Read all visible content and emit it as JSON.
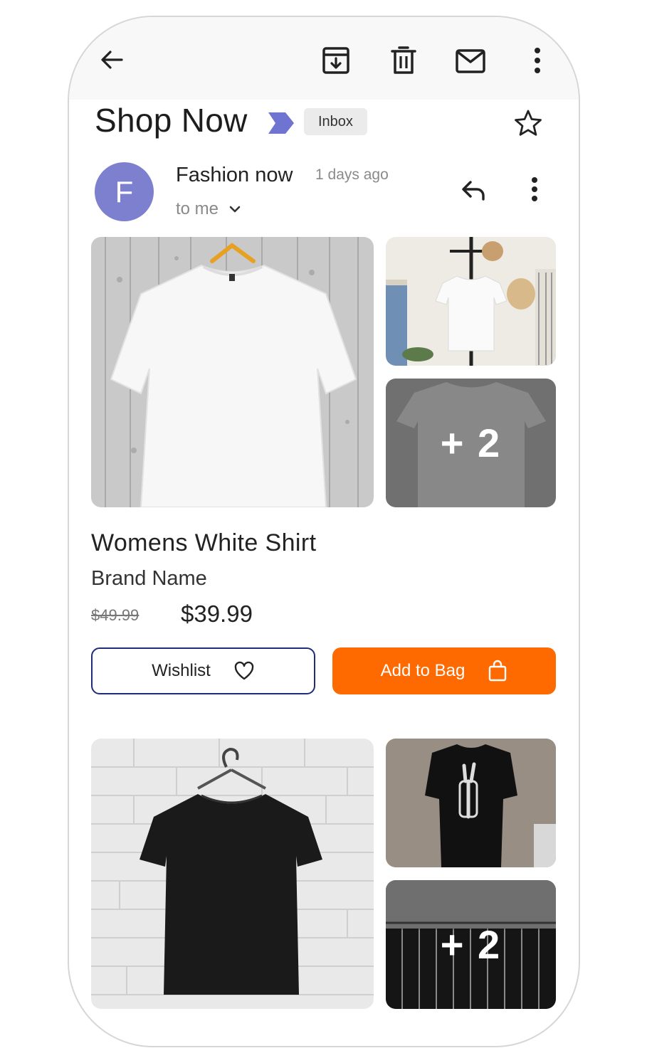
{
  "email": {
    "subject": "Shop Now",
    "folder_label": "Inbox",
    "sender": {
      "initial": "F",
      "name": "Fashion now",
      "time": "1 days ago",
      "recipient": "to me"
    }
  },
  "product1": {
    "title": "Womens White Shirt",
    "brand": "Brand Name",
    "old_price": "$49.99",
    "price": "$39.99",
    "extra_images": "+ 2"
  },
  "product2": {
    "extra_images": "+ 2"
  },
  "actions": {
    "wishlist_label": "Wishlist",
    "add_to_bag_label": "Add to Bag"
  },
  "icons": {
    "toolbar": [
      "back-arrow-icon",
      "archive-icon",
      "trash-icon",
      "mail-icon",
      "more-vert-icon"
    ],
    "message": [
      "reply-icon",
      "more-vert-icon"
    ]
  },
  "colors": {
    "avatar": "#7c80cf",
    "label_tag": "#6f74d1",
    "add_to_bag": "#ff6a00",
    "wishlist_border": "#1f2c7a"
  }
}
